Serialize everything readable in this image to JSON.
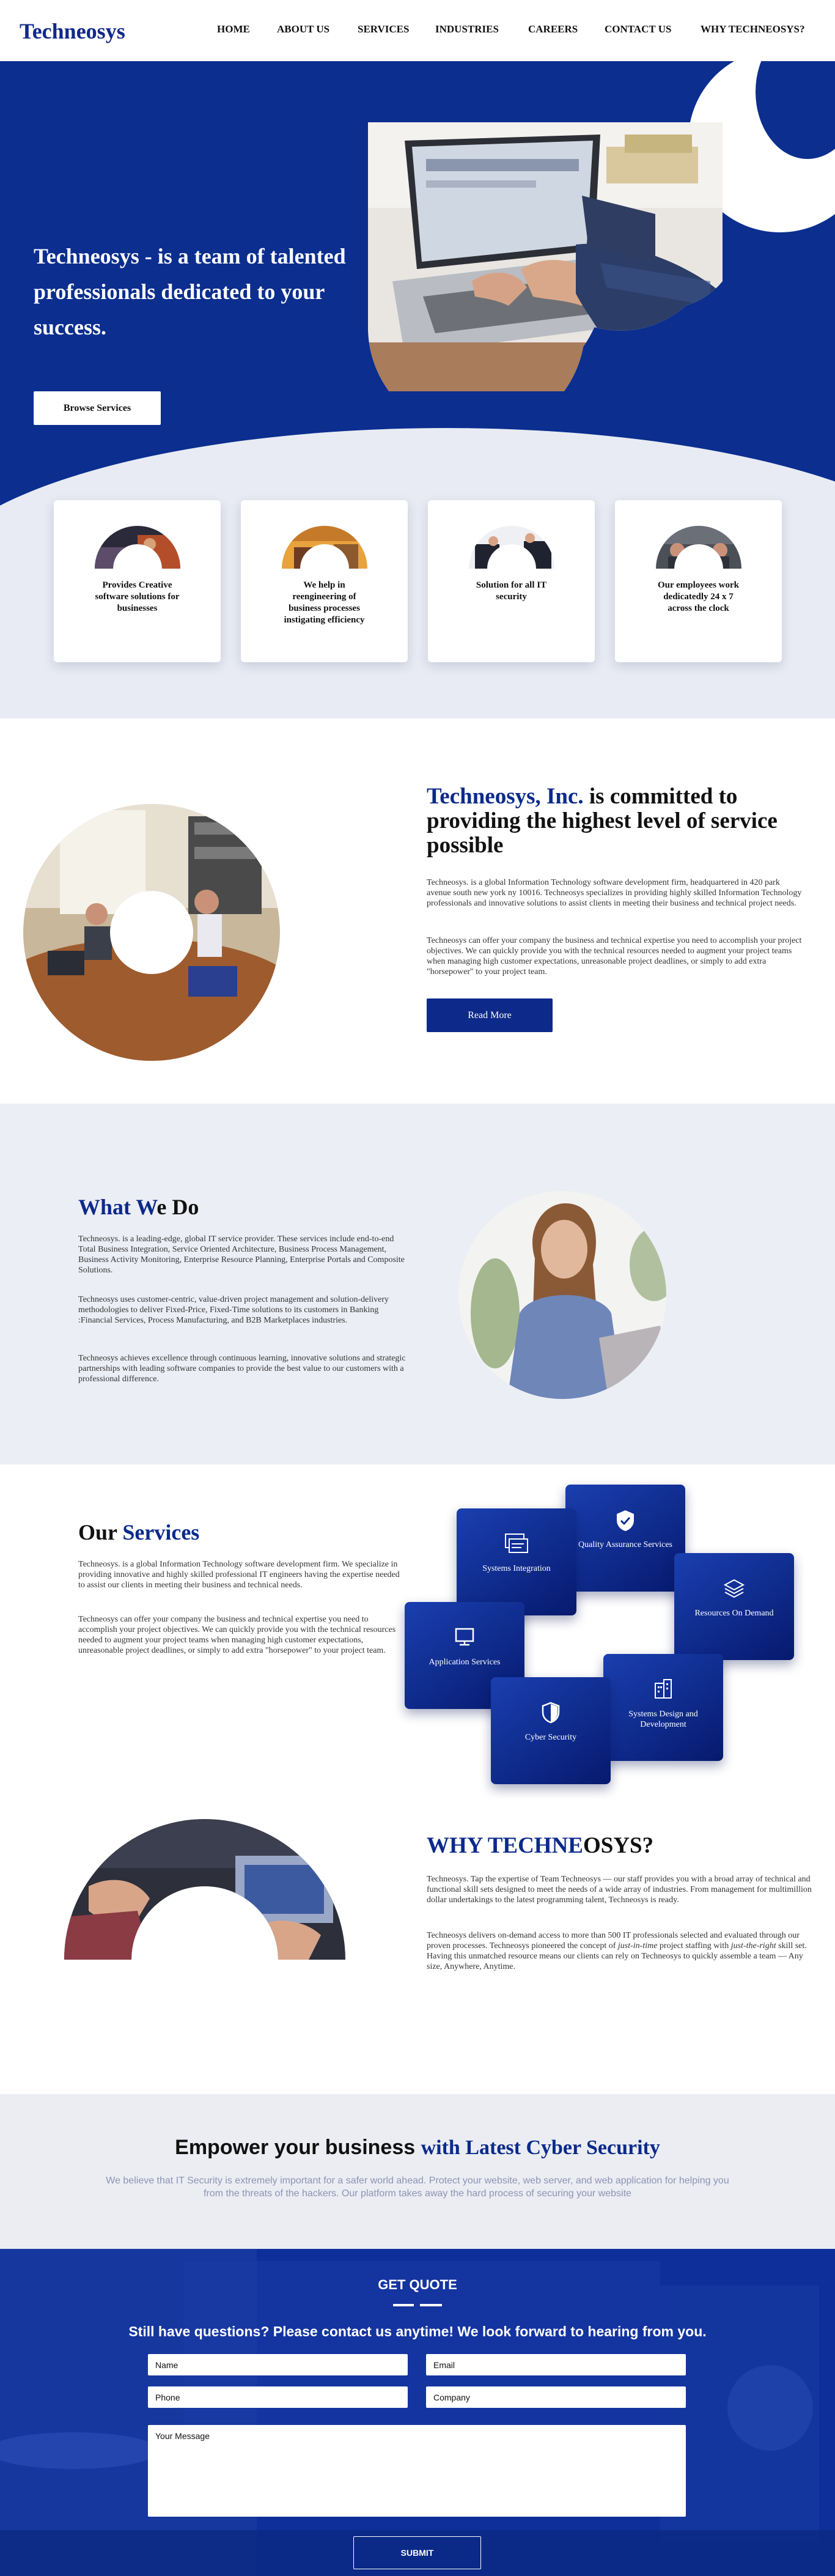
{
  "brand": {
    "logo": "Techneosys"
  },
  "nav": {
    "items": [
      "HOME",
      "ABOUT US",
      "SERVICES",
      "INDUSTRIES",
      "CAREERS",
      "CONTACT US",
      "WHY TECHNEOSYS?"
    ]
  },
  "hero": {
    "title": "Techneosys - is a team of talented professionals dedicated to your success.",
    "button": "Browse Services"
  },
  "cards": [
    {
      "text": "Provides Creative software solutions for businesses"
    },
    {
      "text": "We help in reengineering of business processes instigating efficiency"
    },
    {
      "text": "Solution for all IT security"
    },
    {
      "text": "Our employees work dedicatedly 24 x 7 across the clock"
    }
  ],
  "about": {
    "heading_company": "Techneosys, Inc.",
    "heading_rest": " is committed to providing the highest level of service possible",
    "p1": "Techneosys. is a global Information Technology software development firm, headquartered in 420 park avenue south new york ny 10016. Techneosys specializes in providing highly skilled Information Technology professionals and innovative solutions to assist clients in meeting their business and technical project needs.",
    "p2": "Techneosys can offer your company the business and technical expertise you need to accomplish your project objectives. We can quickly provide you with the technical resources needed to augment your project teams when managing high customer expectations, unreasonable project deadlines, or simply to add extra \"horsepower\" to your project team.",
    "button": "Read More"
  },
  "what": {
    "heading_a": "What W",
    "heading_b": "e Do",
    "p1": "Techneosys. is a leading-edge, global IT service provider. These services include end-to-end Total Business Integration, Service Oriented Architecture, Business Process Management, Business Activity Monitoring, Enterprise Resource Planning, Enterprise Portals and Composite Solutions.",
    "p2": "Techneosys uses customer-centric, value-driven project management and solution-delivery methodologies to deliver Fixed-Price, Fixed-Time solutions to its customers in Banking :Financial Services, Process Manufacturing, and B2B Marketplaces industries.",
    "p3": "Techneosys achieves excellence through continuous learning, innovative solutions and strategic partnerships with leading software companies to provide the best value to our customers with a professional difference."
  },
  "services": {
    "heading_a": "Our ",
    "heading_b": "Services",
    "p1": "Techneosys. is a global Information Technology software development firm. We specialize in providing innovative and highly skilled professional IT engineers having the expertise needed to assist our clients in meeting their business and technical needs.",
    "p2": "Techneosys can offer your company the business and technical expertise you need to accomplish your project objectives. We can quickly provide you with the technical resources needed to augment your project teams when managing high customer expectations, unreasonable project deadlines, or simply to add extra \"horsepower\" to your project team.",
    "tiles": [
      {
        "label": "Quality Assurance Services",
        "icon": "shield-check-icon"
      },
      {
        "label": "Systems Integration",
        "icon": "window-stack-icon"
      },
      {
        "label": "Resources On Demand",
        "icon": "layers-icon"
      },
      {
        "label": "Application Services",
        "icon": "monitor-icon"
      },
      {
        "label": "Systems Design and Development",
        "icon": "building-icon"
      },
      {
        "label": "Cyber Security",
        "icon": "shield-icon"
      }
    ]
  },
  "why": {
    "heading_a": "WHY TECHNE",
    "heading_b": "OSYS?",
    "p1": "Techneosys. Tap the expertise of Team Techneosys — our staff provides you with a broad array of technical and functional skill sets designed to meet the needs of a wide array of industries. From management for multimillion dollar undertakings to the latest programming talent, Techneosys is ready.",
    "p2_a": "Techneosys delivers on-demand access to more than 500 IT professionals selected and evaluated through our proven processes. Techneosys pioneered the concept of ",
    "p2_em": "just-in-time",
    "p2_b": " project staffing with ",
    "p2_em2": "just-the-right",
    "p2_c": " skill set. Having this unmatched resource means our clients can rely on Techneosys to quickly assemble a team — Any size, Anywhere, Anytime."
  },
  "cyber": {
    "heading_a": "Empower your business ",
    "heading_b": "with Latest Cyber Security",
    "text": "We believe that IT Security is extremely important for a safer world ahead. Protect your website, web server, and web application for helping you from the threats of the hackers. Our platform takes away the hard process of securing your website"
  },
  "quote": {
    "title": "GET QUOTE",
    "subtitle": "Still have questions? Please contact us anytime! We look forward to hearing from you.",
    "name_placeholder": "Name",
    "email_placeholder": "Email",
    "phone_placeholder": "Phone",
    "company_placeholder": "Company",
    "message_placeholder": "Your Message",
    "submit": "SUBMIT"
  },
  "colors": {
    "primary": "#0b2e8f",
    "light_bg": "#e8ebf3",
    "text": "#111111"
  }
}
